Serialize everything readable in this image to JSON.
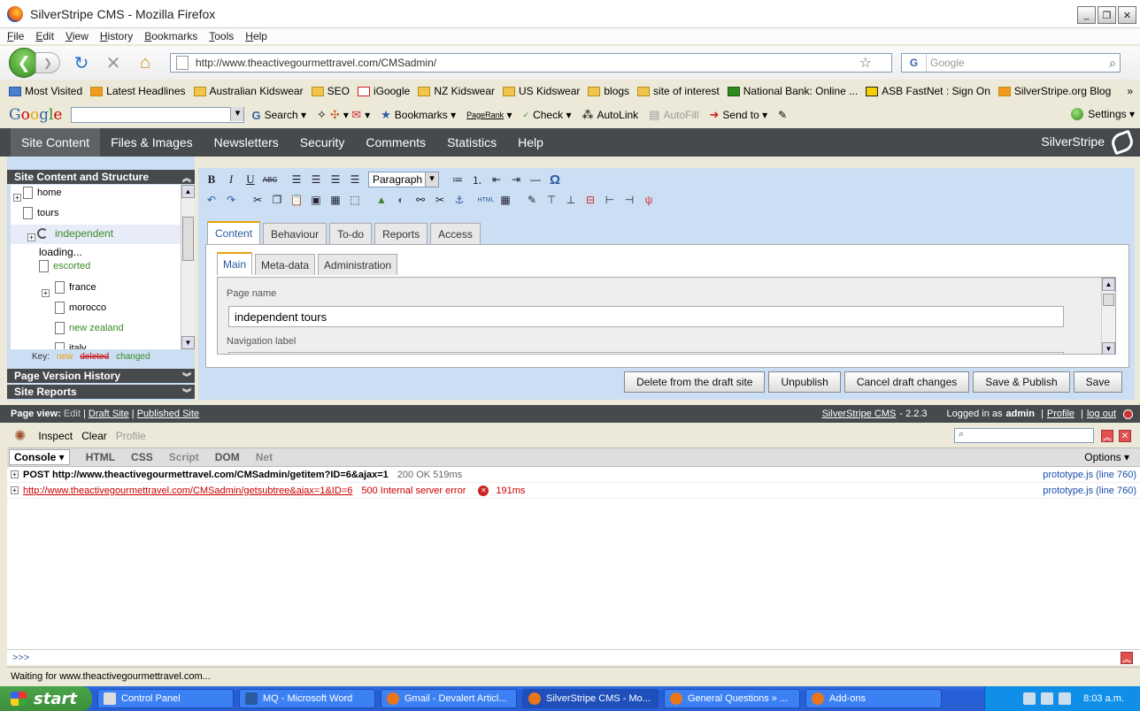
{
  "window": {
    "title": "SilverStripe CMS - Mozilla Firefox",
    "controls": [
      "_",
      "❐",
      "✕"
    ]
  },
  "menu": [
    "File",
    "Edit",
    "View",
    "History",
    "Bookmarks",
    "Tools",
    "Help"
  ],
  "nav": {
    "url": "http://www.theactivegourmettravel.com/CMSadmin/",
    "search_placeholder": "Google"
  },
  "bookmarks": [
    "Most Visited",
    "Latest Headlines",
    "Australian Kidswear",
    "SEO",
    "iGoogle",
    "NZ Kidswear",
    "US Kidswear",
    "blogs",
    "site of interest",
    "National Bank: Online ...",
    "ASB FastNet : Sign On",
    "SilverStripe.org Blog"
  ],
  "google_toolbar": {
    "logo": [
      "G",
      "o",
      "o",
      "g",
      "l",
      "e"
    ],
    "search": "Search",
    "bookmarks": "Bookmarks",
    "pagerank": "PageRank",
    "check": "Check",
    "autolink": "AutoLink",
    "autofill": "AutoFill",
    "sendto": "Send to",
    "settings": "Settings"
  },
  "cms_nav": {
    "tabs": [
      "Site Content",
      "Files & Images",
      "Newsletters",
      "Security",
      "Comments",
      "Statistics",
      "Help"
    ],
    "brand": "SilverStripe"
  },
  "left": {
    "tree_header": "Site Content and Structure",
    "tree": {
      "home": "home",
      "tours": "tours",
      "independent": "independent",
      "loading": "loading...",
      "escorted": "escorted",
      "france": "france",
      "morocco": "morocco",
      "newzealand": "new zealand",
      "italy": "italy"
    },
    "key_label": "Key:",
    "key_new": "new",
    "key_deleted": "deleted",
    "key_changed": "changed",
    "version_header": "Page Version History",
    "reports_header": "Site Reports"
  },
  "editor": {
    "format": "Paragraph",
    "tabs": [
      "Content",
      "Behaviour",
      "To-do",
      "Reports",
      "Access"
    ],
    "subtabs": [
      "Main",
      "Meta-data",
      "Administration"
    ],
    "page_name_label": "Page name",
    "page_name_value": "independent tours",
    "nav_label": "Navigation label",
    "actions": [
      "Delete from the draft site",
      "Unpublish",
      "Cancel draft changes",
      "Save & Publish",
      "Save"
    ]
  },
  "cms_status": {
    "page_view": "Page view:",
    "edit": "Edit",
    "draft": "Draft Site",
    "published": "Published Site",
    "cms": "SilverStripe CMS",
    "version": "- 2.2.3",
    "logged_in_pre": "Logged in as",
    "user": "admin",
    "profile": "Profile",
    "logout": "log out"
  },
  "firebug": {
    "inspect": "Inspect",
    "clear": "Clear",
    "profile": "Profile",
    "tabs": [
      "Console ▾",
      "HTML",
      "CSS",
      "Script",
      "DOM",
      "Net"
    ],
    "options": "Options ▾",
    "rows": [
      {
        "text": "POST http://www.theactivegourmettravel.com/CMSadmin/getitem?ID=6&ajax=1",
        "meta": "200 OK 519ms",
        "src": "prototype.js (line 760)"
      },
      {
        "text": "http://www.theactivegourmettravel.com/CMSadmin/getsubtree&ajax=1&ID=6",
        "meta": "500 Internal server error",
        "time": "191ms",
        "src": "prototype.js (line 760)"
      }
    ],
    "prompt": ">>>"
  },
  "status_bar": "Waiting for www.theactivegourmettravel.com...",
  "taskbar": {
    "start": "start",
    "tasks": [
      "Control Panel",
      "MQ - Microsoft Word",
      "Gmail - Devalert Articl...",
      "SilverStripe CMS - Mo...",
      "General Questions » ...",
      "Add-ons"
    ],
    "clock": "8:03 a.m."
  }
}
